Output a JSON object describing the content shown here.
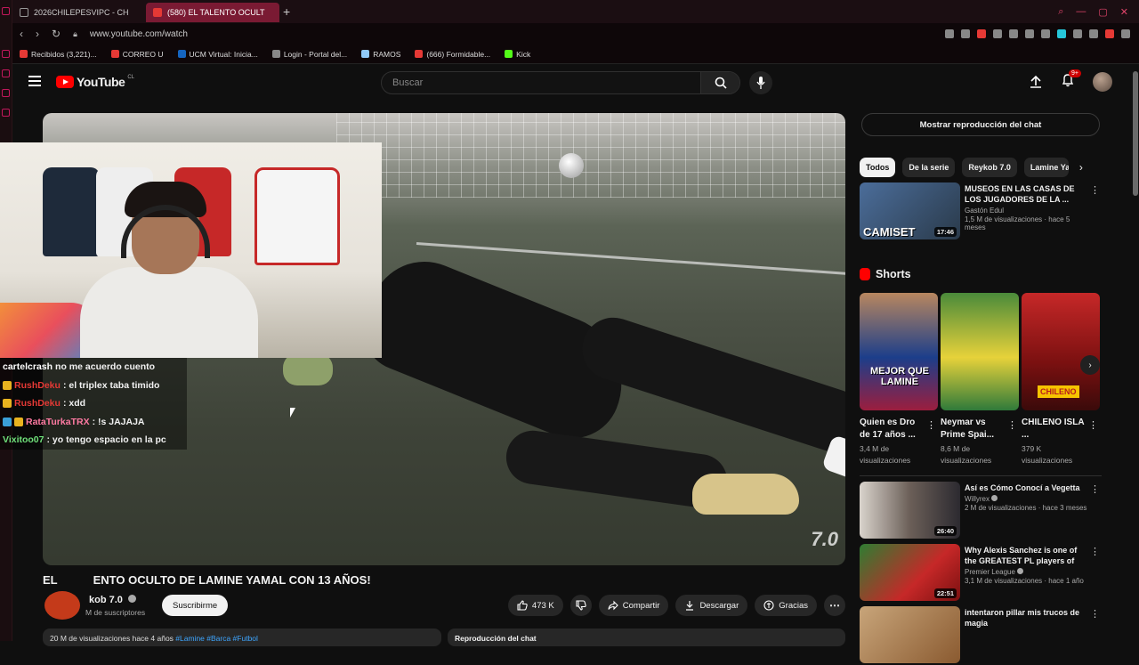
{
  "browser": {
    "tabs": [
      {
        "label": "2026CHILEPESVIPC - CH"
      },
      {
        "label": "(580) EL TALENTO OCULT"
      }
    ],
    "url": "www.youtube.com/watch",
    "bookmarks": [
      {
        "label": "Recibidos (3,221)...",
        "color": "#e53935"
      },
      {
        "label": "CORREO U",
        "color": "#e53935"
      },
      {
        "label": "UCM Virtual: Inicia...",
        "color": "#1565c0"
      },
      {
        "label": "Login - Portal del...",
        "color": "#888888"
      },
      {
        "label": "RAMOS",
        "color": "#90caf9"
      },
      {
        "label": "(666) Formidable...",
        "color": "#e53935"
      },
      {
        "label": "Kick",
        "color": "#53fc18"
      }
    ]
  },
  "header": {
    "logo": "YouTube",
    "country": "CL",
    "search_placeholder": "Buscar",
    "notification_count": "9+"
  },
  "video": {
    "title_parts": [
      "EL",
      "ENTO OCULTO DE LAMINE YAMAL CON 13 AÑOS!"
    ],
    "watermark": "7.0",
    "chat_lines": [
      {
        "user": "cartelcrash",
        "user_color": "#ffffff",
        "text": " no me acuerdo cuento"
      },
      {
        "user": "RushDeku",
        "user_color": "#e53935",
        "text": ": el triplex taba timido"
      },
      {
        "user": "RushDeku",
        "user_color": "#e53935",
        "text": ": xdd"
      },
      {
        "user": "RataTurkaTRX",
        "user_color": "#ff7aa2",
        "text": ": !s JAJAJA"
      },
      {
        "user": "Vixitoo07",
        "user_color": "#6fe07a",
        "text": ": yo tengo espacio en la pc"
      }
    ]
  },
  "channel": {
    "name": "kob 7.0",
    "subs": "M de suscriptores",
    "subscribe_label": "Suscribirme"
  },
  "actions": {
    "likes": "473 K",
    "share": "Compartir",
    "download": "Descargar",
    "thanks": "Gracias"
  },
  "description": {
    "stats": "20 M de visualizaciones  hace 4 años",
    "tags": "#Lamine #Barca #Futbol"
  },
  "chat_replay": {
    "label": "Reproducción del chat",
    "show_button": "Mostrar reproducción del chat"
  },
  "chips": [
    "Todos",
    "De la serie",
    "Reykob 7.0",
    "Lamine Ya"
  ],
  "top_rec": {
    "title": "MUSEOS EN LAS CASAS DE LOS JUGADORES DE LA ...",
    "channel": "Gastón Edul",
    "meta": "1,5 M de visualizaciones · hace 5 meses",
    "duration": "17:46",
    "thumb_text": "CAMISET"
  },
  "shorts": {
    "heading": "Shorts",
    "items": [
      {
        "title": "Quien es Dro de 17 años ...",
        "views_1": "3,4 M de",
        "views_2": "visualizaciones",
        "thumb_text": "MEJOR QUE LAMINE"
      },
      {
        "title": "Neymar vs Prime Spai...",
        "views_1": "8,6 M de",
        "views_2": "visualizaciones",
        "thumb_text": ""
      },
      {
        "title": "CHILENO ISLA ...",
        "views_1": "379 K",
        "views_2": "visualizaciones",
        "thumb_text": "CHILENO"
      }
    ]
  },
  "recs": [
    {
      "title": "Así es Cómo Conocí a Vegetta",
      "channel": "Willyrex",
      "meta": "2 M de visualizaciones · hace 3 meses",
      "duration": "26:40"
    },
    {
      "title": "Why Alexis Sanchez is one of the GREATEST PL players of al...",
      "channel": "Premier League",
      "meta": "3,1 M de visualizaciones · hace 1 año",
      "duration": "22:51"
    },
    {
      "title": "intentaron pillar mis trucos de magia",
      "channel": "",
      "meta": "",
      "duration": ""
    }
  ]
}
